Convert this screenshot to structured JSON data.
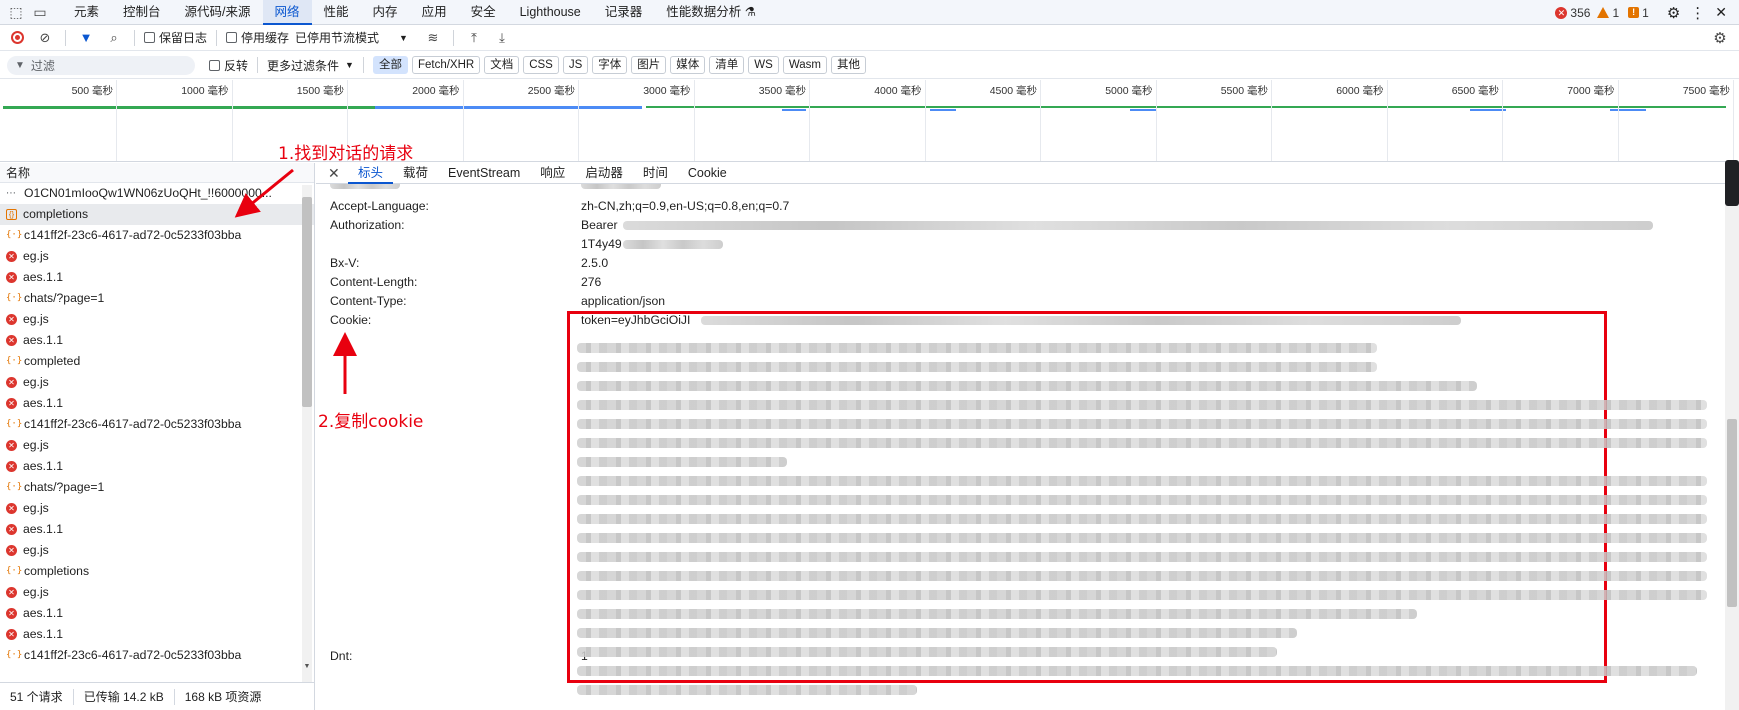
{
  "main_tabs": [
    "元素",
    "控制台",
    "源代码/来源",
    "网络",
    "性能",
    "内存",
    "应用",
    "安全",
    "Lighthouse",
    "记录器",
    "性能数据分析 ⚗"
  ],
  "main_tabs_active_index": 3,
  "issues": {
    "errors": "356",
    "warnings": "1",
    "info": "1"
  },
  "toolbar": {
    "preserve_log": "保留日志",
    "disable_cache": "停用缓存",
    "throttle": "已停用节流模式"
  },
  "filter": {
    "placeholder": "过滤",
    "invert": "反转",
    "more_filters": "更多过滤条件",
    "chips": [
      "全部",
      "Fetch/XHR",
      "文档",
      "CSS",
      "JS",
      "字体",
      "图片",
      "媒体",
      "清单",
      "WS",
      "Wasm",
      "其他"
    ],
    "active_chip_index": 0
  },
  "timeline": {
    "ticks": [
      "500 毫秒",
      "1000 毫秒",
      "1500 毫秒",
      "2000 毫秒",
      "2500 毫秒",
      "3000 毫秒",
      "3500 毫秒",
      "4000 毫秒",
      "4500 毫秒",
      "5000 毫秒",
      "5500 毫秒",
      "6000 毫秒",
      "6500 毫秒",
      "7000 毫秒",
      "7500 毫秒"
    ]
  },
  "request_list": {
    "header": "名称",
    "rows": [
      {
        "name": "O1CN01mIooQw1WN06zUoQHt_!!6000000...",
        "icon": "doc-icon"
      },
      {
        "name": "completions",
        "icon": "fetch-icon",
        "selected": true
      },
      {
        "name": "c141ff2f-23c6-4617-ad72-0c5233f03bba",
        "icon": "fetch-icon"
      },
      {
        "name": "eg.js",
        "icon": "error-icon"
      },
      {
        "name": "aes.1.1",
        "icon": "error-icon"
      },
      {
        "name": "chats/?page=1",
        "icon": "fetch-icon"
      },
      {
        "name": "eg.js",
        "icon": "error-icon"
      },
      {
        "name": "aes.1.1",
        "icon": "error-icon"
      },
      {
        "name": "completed",
        "icon": "fetch-icon"
      },
      {
        "name": "eg.js",
        "icon": "error-icon"
      },
      {
        "name": "aes.1.1",
        "icon": "error-icon"
      },
      {
        "name": "c141ff2f-23c6-4617-ad72-0c5233f03bba",
        "icon": "fetch-icon"
      },
      {
        "name": "eg.js",
        "icon": "error-icon"
      },
      {
        "name": "aes.1.1",
        "icon": "error-icon"
      },
      {
        "name": "chats/?page=1",
        "icon": "fetch-icon"
      },
      {
        "name": "eg.js",
        "icon": "error-icon"
      },
      {
        "name": "aes.1.1",
        "icon": "error-icon"
      },
      {
        "name": "eg.js",
        "icon": "error-icon"
      },
      {
        "name": "completions",
        "icon": "fetch-icon"
      },
      {
        "name": "eg.js",
        "icon": "error-icon"
      },
      {
        "name": "aes.1.1",
        "icon": "error-icon"
      },
      {
        "name": "aes.1.1",
        "icon": "error-icon"
      },
      {
        "name": "c141ff2f-23c6-4617-ad72-0c5233f03bba",
        "icon": "fetch-icon"
      }
    ]
  },
  "status": {
    "requests": "51 个请求",
    "transferred": "已传输 14.2 kB",
    "resources": "168 kB 项资源"
  },
  "detail_tabs": [
    "标头",
    "载荷",
    "EventStream",
    "响应",
    "启动器",
    "时间",
    "Cookie"
  ],
  "detail_tabs_active_index": 0,
  "headers": [
    {
      "name": "Accept-Language:",
      "value": "zh-CN,zh;q=0.9,en-US;q=0.8,en;q=0.7"
    },
    {
      "name": "Authorization:",
      "value": "Bearer"
    },
    {
      "name": "",
      "value": "1T4y49"
    },
    {
      "name": "Bx-V:",
      "value": "2.5.0"
    },
    {
      "name": "Content-Length:",
      "value": "276"
    },
    {
      "name": "Content-Type:",
      "value": "application/json"
    },
    {
      "name": "Cookie:",
      "value": "token=eyJhbGciOiJI"
    },
    {
      "name": "Dnt:",
      "value": "1"
    }
  ],
  "annotations": {
    "step1": "1.找到对话的请求",
    "step2": "2.复制cookie"
  },
  "colors": {
    "accent": "#0b57d0",
    "error": "#dc362e",
    "annotation": "#e8000f"
  }
}
